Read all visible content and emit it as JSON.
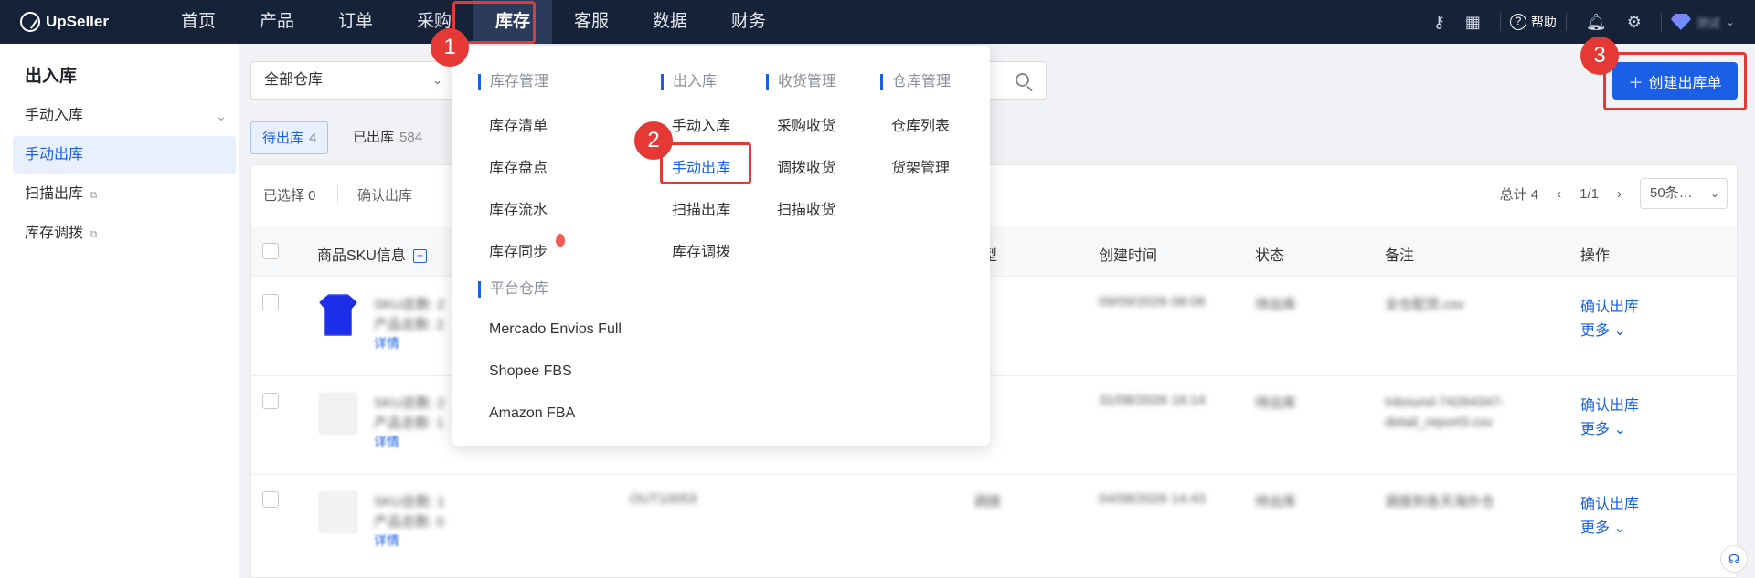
{
  "app": {
    "name": "UpSeller"
  },
  "nav": {
    "items": [
      "首页",
      "产品",
      "订单",
      "采购",
      "库存",
      "客服",
      "数据",
      "财务"
    ],
    "active_index": 4,
    "help_label": "帮助",
    "user_name": "测试"
  },
  "sidebar": {
    "title": "出入库",
    "items": [
      {
        "label": "手动入库"
      },
      {
        "label": "手动出库"
      },
      {
        "label": "扫描出库"
      },
      {
        "label": "库存调拨"
      }
    ]
  },
  "filters": {
    "warehouse": "全部仓库"
  },
  "create_button": {
    "label": "创建出库单"
  },
  "tabs": [
    {
      "label": "待出库",
      "count": "4"
    },
    {
      "label": "已出库",
      "count": "584"
    }
  ],
  "toolbar": {
    "selected_label": "已选择 0",
    "confirm_label": "确认出库"
  },
  "pager": {
    "total": "总计 4",
    "page": "1/1",
    "per_page": "50条…"
  },
  "table": {
    "headers": [
      "商品SKU信息",
      "型",
      "创建时间",
      "状态",
      "备注",
      "操作"
    ],
    "rows": [
      {
        "sku": "SKU总数: 2",
        "products": "产品总数: 2",
        "detail": "详情",
        "code": "",
        "type": "",
        "created": "09/09/2026 08:06",
        "status": "待出库",
        "note": "全仓配货.csv",
        "action": "确认出库",
        "more": "更多"
      },
      {
        "sku": "SKU总数: 2",
        "products": "产品总数: 1",
        "detail": "详情",
        "code": "",
        "type": "",
        "created": "31/08/2026 16:14",
        "status": "待出库",
        "note": "Inbound-74264347-detail_report3.csv",
        "action": "确认出库",
        "more": "更多"
      },
      {
        "sku": "SKU总数: 1",
        "products": "产品总数: 0",
        "detail": "详情",
        "code": "OUT10053",
        "type": "调拨",
        "created": "04/08/2026 14:43",
        "status": "待出库",
        "note": "调拨到各天海外仓",
        "action": "确认出库",
        "more": "更多"
      }
    ]
  },
  "menu": {
    "groups": {
      "inventory": "库存管理",
      "inout": "出入库",
      "receiving": "收货管理",
      "warehouse": "仓库管理",
      "platform": "平台仓库"
    },
    "inventory_items": [
      "库存清单",
      "库存盘点",
      "库存流水",
      "库存同步"
    ],
    "platform_items": [
      "Mercado Envios Full",
      "Shopee FBS",
      "Amazon FBA"
    ],
    "inout_items": [
      "手动入库",
      "手动出库",
      "扫描出库",
      "库存调拨"
    ],
    "receiving_items": [
      "采购收货",
      "调拨收货",
      "扫描收货"
    ],
    "warehouse_items": [
      "仓库列表",
      "货架管理"
    ]
  },
  "annotations": [
    "1",
    "2",
    "3"
  ],
  "colors": {
    "nav_bg": "#152238",
    "accent": "#1a5fe6",
    "highlight": "#e53935"
  }
}
